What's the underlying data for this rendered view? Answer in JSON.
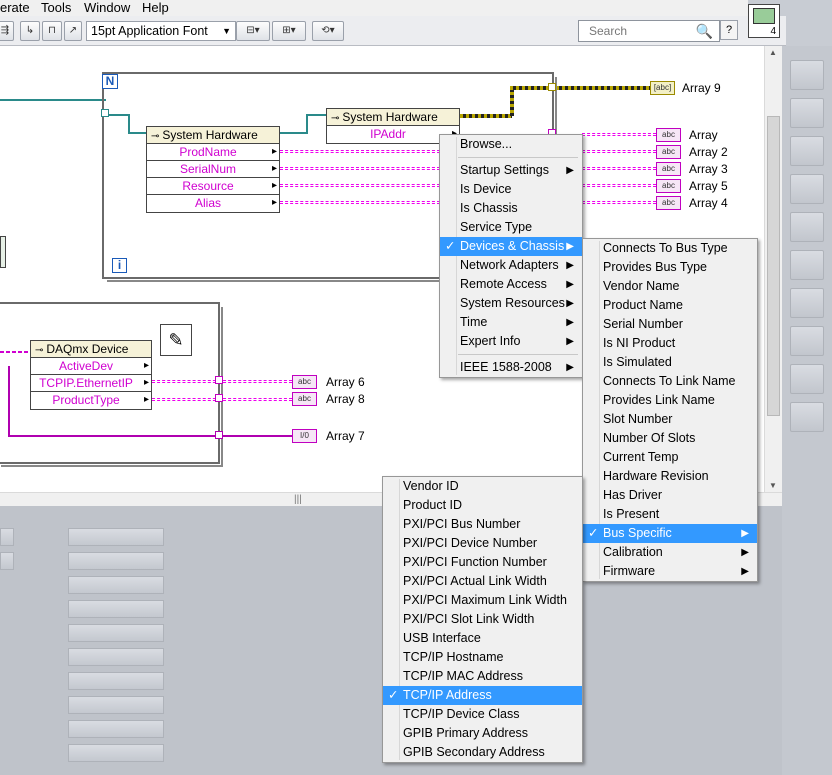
{
  "menubar": [
    "erate",
    "Tools",
    "Window",
    "Help"
  ],
  "toolbar": {
    "font_selector": "15pt Application Font",
    "search_placeholder": "Search",
    "help_label": "?",
    "vi_icon_number": "4"
  },
  "diagram": {
    "loop_label": "N",
    "loop_index_label": "i",
    "node1": {
      "title": "System Hardware",
      "items": [
        "ProdName",
        "SerialNum",
        "Resource",
        "Alias"
      ]
    },
    "node2": {
      "title": "System Hardware",
      "items": [
        "IPAddr"
      ]
    },
    "node3": {
      "title": "DAQmx Device",
      "items": [
        "ActiveDev",
        "TCPIP.EthernetIP",
        "ProductType"
      ]
    },
    "indicators": [
      {
        "label": "Array 9",
        "glyph": "[abc]"
      },
      {
        "label": "Array",
        "glyph": "abc"
      },
      {
        "label": "Array 2",
        "glyph": "abc"
      },
      {
        "label": "Array 3",
        "glyph": "abc"
      },
      {
        "label": "Array 5",
        "glyph": "abc"
      },
      {
        "label": "Array 4",
        "glyph": "abc"
      },
      {
        "label": "Array 6",
        "glyph": "abc"
      },
      {
        "label": "Array 8",
        "glyph": "abc"
      },
      {
        "label": "Array 7",
        "glyph": "I/0"
      }
    ]
  },
  "menu1": {
    "browse": "Browse...",
    "items": [
      {
        "label": "Startup Settings",
        "sub": true
      },
      {
        "label": "Is Device",
        "sub": false
      },
      {
        "label": "Is Chassis",
        "sub": false
      },
      {
        "label": "Service Type",
        "sub": false
      },
      {
        "label": "Devices & Chassis",
        "sub": true,
        "checked": true,
        "highlight": true
      },
      {
        "label": "Network Adapters",
        "sub": true
      },
      {
        "label": "Remote Access",
        "sub": true
      },
      {
        "label": "System Resources",
        "sub": true
      },
      {
        "label": "Time",
        "sub": true
      },
      {
        "label": "Expert Info",
        "sub": true
      }
    ],
    "footer": {
      "label": "IEEE 1588-2008",
      "sub": true
    }
  },
  "menu2": {
    "items": [
      {
        "label": "Connects To Bus Type"
      },
      {
        "label": "Provides Bus Type"
      },
      {
        "label": "Vendor Name"
      },
      {
        "label": "Product Name"
      },
      {
        "label": "Serial Number"
      },
      {
        "label": "Is NI Product"
      },
      {
        "label": "Is Simulated"
      },
      {
        "label": "Connects To Link Name"
      },
      {
        "label": "Provides Link Name"
      },
      {
        "label": "Slot Number"
      },
      {
        "label": "Number Of Slots"
      },
      {
        "label": "Current Temp"
      },
      {
        "label": "Hardware Revision"
      },
      {
        "label": "Has Driver"
      },
      {
        "label": "Is Present"
      },
      {
        "label": "Bus Specific",
        "sub": true,
        "checked": true,
        "highlight": true
      },
      {
        "label": "Calibration",
        "sub": true
      },
      {
        "label": "Firmware",
        "sub": true
      }
    ]
  },
  "menu3": {
    "items": [
      {
        "label": "Vendor ID"
      },
      {
        "label": "Product ID"
      },
      {
        "label": "PXI/PCI Bus Number"
      },
      {
        "label": "PXI/PCI Device Number"
      },
      {
        "label": "PXI/PCI Function Number"
      },
      {
        "label": "PXI/PCI Actual Link Width"
      },
      {
        "label": "PXI/PCI Maximum Link Width"
      },
      {
        "label": "PXI/PCI Slot Link Width"
      },
      {
        "label": "USB Interface"
      },
      {
        "label": "TCP/IP Hostname"
      },
      {
        "label": "TCP/IP MAC Address"
      },
      {
        "label": "TCP/IP Address",
        "checked": true,
        "highlight": true
      },
      {
        "label": "TCP/IP Device Class"
      },
      {
        "label": "GPIB Primary Address"
      },
      {
        "label": "GPIB Secondary Address"
      }
    ]
  },
  "glyphs": {
    "check": "✓",
    "submenu": "▶",
    "search": "🔍"
  }
}
